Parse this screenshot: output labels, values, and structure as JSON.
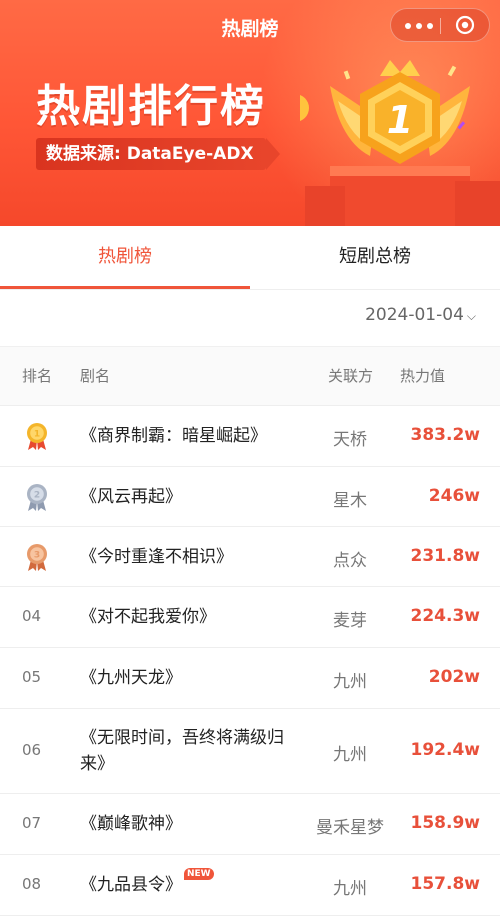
{
  "nav": {
    "title": "热剧榜"
  },
  "hero": {
    "title": "热剧排行榜",
    "source": "数据来源: DataEye-ADX",
    "trophy_number": "1"
  },
  "tabs": [
    {
      "label": "热剧榜",
      "active": true
    },
    {
      "label": "短剧总榜",
      "active": false
    }
  ],
  "date": {
    "value": "2024-01-04"
  },
  "table": {
    "headers": {
      "rank": "排名",
      "name": "剧名",
      "party": "关联方",
      "heat": "热力值"
    },
    "rows": [
      {
        "rank": "1",
        "medal": "gold-medal",
        "name": "《商界制霸：暗星崛起》",
        "party": "天桥",
        "heat": "383.2w"
      },
      {
        "rank": "2",
        "medal": "silver-medal",
        "name": "《风云再起》",
        "party": "星木",
        "heat": "246w"
      },
      {
        "rank": "3",
        "medal": "bronze-medal",
        "name": "《今时重逢不相识》",
        "party": "点众",
        "heat": "231.8w"
      },
      {
        "rank": "04",
        "name": "《对不起我爱你》",
        "party": "麦芽",
        "heat": "224.3w"
      },
      {
        "rank": "05",
        "name": "《九州天龙》",
        "party": "九州",
        "heat": "202w"
      },
      {
        "rank": "06",
        "name": "《无限时间，吾终将满级归来》",
        "party": "九州",
        "heat": "192.4w"
      },
      {
        "rank": "07",
        "name": "《巅峰歌神》",
        "party": "曼禾星梦",
        "heat": "158.9w"
      },
      {
        "rank": "08",
        "name": "《九品县令》",
        "badge": "NEW",
        "party": "九州",
        "heat": "157.8w"
      }
    ]
  },
  "colors": {
    "accent": "#f0553a",
    "heat": "#e8503a",
    "hero_bg": "#ff5636"
  }
}
